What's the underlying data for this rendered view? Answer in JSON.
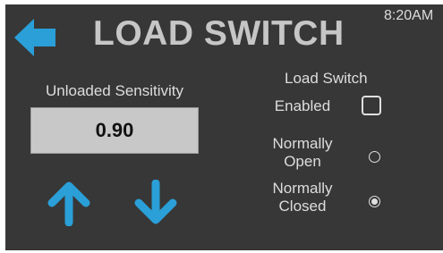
{
  "header": {
    "title": "LOAD SWITCH",
    "time": "8:20AM",
    "back_icon": "arrow-left-icon"
  },
  "sensitivity": {
    "label": "Unloaded Sensitivity",
    "value": "0.90",
    "increase_icon": "arrow-up-icon",
    "decrease_icon": "arrow-down-icon"
  },
  "load_switch": {
    "label": "Load Switch",
    "enabled": {
      "label": "Enabled",
      "checked": false
    },
    "normally_open": {
      "line1": "Normally",
      "line2": "Open",
      "selected": false
    },
    "normally_closed": {
      "line1": "Normally",
      "line2": "Closed",
      "selected": true
    }
  },
  "colors": {
    "background": "#373737",
    "accent_blue": "#2a9fd8",
    "title_gray": "#c6c6c6",
    "value_box": "#c8c8c8"
  }
}
